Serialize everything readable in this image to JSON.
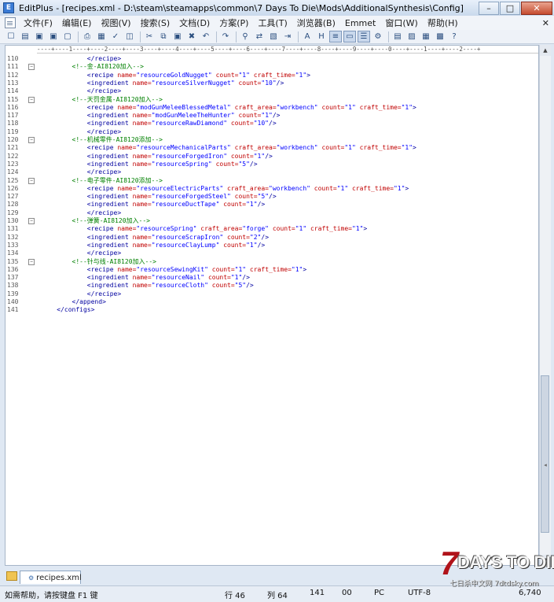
{
  "window": {
    "app_icon": "E",
    "title": "EditPlus - [recipes.xml - D:\\steam\\steamapps\\common\\7 Days To Die\\Mods\\AdditionalSynthesis\\Config]",
    "minimize": "–",
    "maximize": "□",
    "close": "✕"
  },
  "menubar": {
    "items": [
      "文件(F)",
      "编辑(E)",
      "视图(V)",
      "搜索(S)",
      "文档(D)",
      "方案(P)",
      "工具(T)",
      "浏览器(B)",
      "Emmet",
      "窗口(W)",
      "帮助(H)"
    ],
    "mdi_close": "✕"
  },
  "toolbar": {
    "icons": [
      "new-file-icon",
      "open-folder-icon",
      "save-icon",
      "save-all-icon",
      "close-file-icon",
      "print-icon",
      "print-preview-icon",
      "spell-check-icon",
      "browser-preview-icon",
      "cut-icon",
      "copy-icon",
      "paste-icon",
      "delete-icon",
      "undo-icon",
      "redo-icon",
      "find-icon",
      "replace-icon",
      "find-in-files-icon",
      "goto-line-icon",
      "font-icon",
      "heading-icon",
      "word-wrap-icon",
      "ruler-toggle-icon",
      "line-numbers-icon",
      "settings-icon",
      "window-tile-icon",
      "window-cascade-icon",
      "window-list-icon",
      "window-arrange-icon",
      "help-icon"
    ],
    "glyphs": [
      "☐",
      "▤",
      "▣",
      "▣",
      "▢",
      "⎙",
      "▦",
      "✓",
      "◫",
      "✂",
      "⧉",
      "▣",
      "✖",
      "↶",
      "↷",
      "⚲",
      "⇄",
      "▧",
      "⇥",
      "A",
      "H",
      "≡",
      "▭",
      "☰",
      "⚙",
      "▤",
      "▨",
      "▦",
      "▩",
      "?"
    ]
  },
  "editor": {
    "ruler": "----+----1----+----2----+----3----+----4----+----5----+----6----+----7----+----8----+----9----+----0----+----1----+----2----+",
    "lines": [
      {
        "n": "110",
        "fold": false,
        "segs": [
          [
            "txt",
            "            "
          ],
          [
            "tag",
            "</recipe>"
          ]
        ]
      },
      {
        "n": "111",
        "fold": true,
        "segs": [
          [
            "txt",
            "        "
          ],
          [
            "cmt",
            "<!--金-AI8120加入-->"
          ]
        ]
      },
      {
        "n": "112",
        "fold": false,
        "segs": [
          [
            "txt",
            "            "
          ],
          [
            "tag",
            "<recipe "
          ],
          [
            "attr",
            "name="
          ],
          [
            "val",
            "\"resourceGoldNugget\""
          ],
          [
            "attr",
            " count="
          ],
          [
            "val",
            "\"1\""
          ],
          [
            "attr",
            " craft_time="
          ],
          [
            "val",
            "\"1\""
          ],
          [
            "tag",
            ">"
          ]
        ]
      },
      {
        "n": "113",
        "fold": false,
        "segs": [
          [
            "txt",
            "            "
          ],
          [
            "tag",
            "<ingredient "
          ],
          [
            "attr",
            "name="
          ],
          [
            "val",
            "\"resourceSilverNugget\""
          ],
          [
            "attr",
            " count="
          ],
          [
            "val",
            "\"10\""
          ],
          [
            "tag",
            "/>"
          ]
        ]
      },
      {
        "n": "114",
        "fold": false,
        "segs": [
          [
            "txt",
            "            "
          ],
          [
            "tag",
            "</recipe>"
          ]
        ]
      },
      {
        "n": "115",
        "fold": true,
        "segs": [
          [
            "txt",
            "        "
          ],
          [
            "cmt",
            "<!--天罚金属-AI8120加入-->"
          ]
        ]
      },
      {
        "n": "116",
        "fold": false,
        "segs": [
          [
            "txt",
            "            "
          ],
          [
            "tag",
            "<recipe "
          ],
          [
            "attr",
            "name="
          ],
          [
            "val",
            "\"modGunMeleeBlessedMetal\""
          ],
          [
            "attr",
            " craft_area="
          ],
          [
            "val",
            "\"workbench\""
          ],
          [
            "attr",
            " count="
          ],
          [
            "val",
            "\"1\""
          ],
          [
            "attr",
            " craft_time="
          ],
          [
            "val",
            "\"1\""
          ],
          [
            "tag",
            ">"
          ]
        ]
      },
      {
        "n": "117",
        "fold": false,
        "segs": [
          [
            "txt",
            "            "
          ],
          [
            "tag",
            "<ingredient "
          ],
          [
            "attr",
            "name="
          ],
          [
            "val",
            "\"modGunMeleeTheHunter\""
          ],
          [
            "attr",
            " count="
          ],
          [
            "val",
            "\"1\""
          ],
          [
            "tag",
            "/>"
          ]
        ]
      },
      {
        "n": "118",
        "fold": false,
        "segs": [
          [
            "txt",
            "            "
          ],
          [
            "tag",
            "<ingredient "
          ],
          [
            "attr",
            "name="
          ],
          [
            "val",
            "\"resourceRawDiamond\""
          ],
          [
            "attr",
            " count="
          ],
          [
            "val",
            "\"10\""
          ],
          [
            "tag",
            "/>"
          ]
        ]
      },
      {
        "n": "119",
        "fold": false,
        "segs": [
          [
            "txt",
            "            "
          ],
          [
            "tag",
            "</recipe>"
          ]
        ]
      },
      {
        "n": "120",
        "fold": true,
        "segs": [
          [
            "txt",
            "        "
          ],
          [
            "cmt",
            "<!--机械零件-AI8120添加-->"
          ]
        ]
      },
      {
        "n": "121",
        "fold": false,
        "segs": [
          [
            "txt",
            "            "
          ],
          [
            "tag",
            "<recipe "
          ],
          [
            "attr",
            "name="
          ],
          [
            "val",
            "\"resourceMechanicalParts\""
          ],
          [
            "attr",
            " craft_area="
          ],
          [
            "val",
            "\"workbench\""
          ],
          [
            "attr",
            " count="
          ],
          [
            "val",
            "\"1\""
          ],
          [
            "attr",
            " craft_time="
          ],
          [
            "val",
            "\"1\""
          ],
          [
            "tag",
            ">"
          ]
        ]
      },
      {
        "n": "122",
        "fold": false,
        "segs": [
          [
            "txt",
            "            "
          ],
          [
            "tag",
            "<ingredient "
          ],
          [
            "attr",
            "name="
          ],
          [
            "val",
            "\"resourceForgedIron\""
          ],
          [
            "attr",
            " count="
          ],
          [
            "val",
            "\"1\""
          ],
          [
            "tag",
            "/>"
          ]
        ]
      },
      {
        "n": "123",
        "fold": false,
        "segs": [
          [
            "txt",
            "            "
          ],
          [
            "tag",
            "<ingredient "
          ],
          [
            "attr",
            "name="
          ],
          [
            "val",
            "\"resourceSpring\""
          ],
          [
            "attr",
            " count="
          ],
          [
            "val",
            "\"5\""
          ],
          [
            "tag",
            "/>"
          ]
        ]
      },
      {
        "n": "124",
        "fold": false,
        "segs": [
          [
            "txt",
            "            "
          ],
          [
            "tag",
            "</recipe>"
          ]
        ]
      },
      {
        "n": "125",
        "fold": true,
        "segs": [
          [
            "txt",
            "        "
          ],
          [
            "cmt",
            "<!--电子零件-AI8120添加-->"
          ]
        ]
      },
      {
        "n": "126",
        "fold": false,
        "segs": [
          [
            "txt",
            "            "
          ],
          [
            "tag",
            "<recipe "
          ],
          [
            "attr",
            "name="
          ],
          [
            "val",
            "\"resourceElectricParts\""
          ],
          [
            "attr",
            " craft_area="
          ],
          [
            "val",
            "\"workbench\""
          ],
          [
            "attr",
            " count="
          ],
          [
            "val",
            "\"1\""
          ],
          [
            "attr",
            " craft_time="
          ],
          [
            "val",
            "\"1\""
          ],
          [
            "tag",
            ">"
          ]
        ]
      },
      {
        "n": "127",
        "fold": false,
        "segs": [
          [
            "txt",
            "            "
          ],
          [
            "tag",
            "<ingredient "
          ],
          [
            "attr",
            "name="
          ],
          [
            "val",
            "\"resourceForgedSteel\""
          ],
          [
            "attr",
            " count="
          ],
          [
            "val",
            "\"5\""
          ],
          [
            "tag",
            "/>"
          ]
        ]
      },
      {
        "n": "128",
        "fold": false,
        "segs": [
          [
            "txt",
            "            "
          ],
          [
            "tag",
            "<ingredient "
          ],
          [
            "attr",
            "name="
          ],
          [
            "val",
            "\"resourceDuctTape\""
          ],
          [
            "attr",
            " count="
          ],
          [
            "val",
            "\"1\""
          ],
          [
            "tag",
            "/>"
          ]
        ]
      },
      {
        "n": "129",
        "fold": false,
        "segs": [
          [
            "txt",
            "            "
          ],
          [
            "tag",
            "</recipe>"
          ]
        ]
      },
      {
        "n": "130",
        "fold": true,
        "segs": [
          [
            "txt",
            "        "
          ],
          [
            "cmt",
            "<!--弹簧-AI8120加入-->"
          ]
        ]
      },
      {
        "n": "131",
        "fold": false,
        "segs": [
          [
            "txt",
            "            "
          ],
          [
            "tag",
            "<recipe "
          ],
          [
            "attr",
            "name="
          ],
          [
            "val",
            "\"resourceSpring\""
          ],
          [
            "attr",
            " craft_area="
          ],
          [
            "val",
            "\"forge\""
          ],
          [
            "attr",
            " count="
          ],
          [
            "val",
            "\"1\""
          ],
          [
            "attr",
            " craft_time="
          ],
          [
            "val",
            "\"1\""
          ],
          [
            "tag",
            ">"
          ]
        ]
      },
      {
        "n": "132",
        "fold": false,
        "segs": [
          [
            "txt",
            "            "
          ],
          [
            "tag",
            "<ingredient "
          ],
          [
            "attr",
            "name="
          ],
          [
            "val",
            "\"resourceScrapIron\""
          ],
          [
            "attr",
            " count="
          ],
          [
            "val",
            "\"2\""
          ],
          [
            "tag",
            "/>"
          ]
        ]
      },
      {
        "n": "133",
        "fold": false,
        "segs": [
          [
            "txt",
            "            "
          ],
          [
            "tag",
            "<ingredient "
          ],
          [
            "attr",
            "name="
          ],
          [
            "val",
            "\"resourceClayLump\""
          ],
          [
            "attr",
            " count="
          ],
          [
            "val",
            "\"1\""
          ],
          [
            "tag",
            "/>"
          ]
        ]
      },
      {
        "n": "134",
        "fold": false,
        "segs": [
          [
            "txt",
            "            "
          ],
          [
            "tag",
            "</recipe>"
          ]
        ]
      },
      {
        "n": "135",
        "fold": true,
        "segs": [
          [
            "txt",
            "        "
          ],
          [
            "cmt",
            "<!--针与线-AI8120加入-->"
          ]
        ]
      },
      {
        "n": "136",
        "fold": false,
        "segs": [
          [
            "txt",
            "            "
          ],
          [
            "tag",
            "<recipe "
          ],
          [
            "attr",
            "name="
          ],
          [
            "val",
            "\"resourceSewingKit\""
          ],
          [
            "attr",
            " count="
          ],
          [
            "val",
            "\"1\""
          ],
          [
            "attr",
            " craft_time="
          ],
          [
            "val",
            "\"1\""
          ],
          [
            "tag",
            ">"
          ]
        ]
      },
      {
        "n": "137",
        "fold": false,
        "segs": [
          [
            "txt",
            "            "
          ],
          [
            "tag",
            "<ingredient "
          ],
          [
            "attr",
            "name="
          ],
          [
            "val",
            "\"resourceNail\""
          ],
          [
            "attr",
            " count="
          ],
          [
            "val",
            "\"1\""
          ],
          [
            "tag",
            "/>"
          ]
        ]
      },
      {
        "n": "138",
        "fold": false,
        "segs": [
          [
            "txt",
            "            "
          ],
          [
            "tag",
            "<ingredient "
          ],
          [
            "attr",
            "name="
          ],
          [
            "val",
            "\"resourceCloth\""
          ],
          [
            "attr",
            " count="
          ],
          [
            "val",
            "\"5\""
          ],
          [
            "tag",
            "/>"
          ]
        ]
      },
      {
        "n": "139",
        "fold": false,
        "segs": [
          [
            "txt",
            "            "
          ],
          [
            "tag",
            "</recipe>"
          ]
        ]
      },
      {
        "n": "140",
        "fold": false,
        "segs": [
          [
            "txt",
            "        "
          ],
          [
            "tag",
            "</append>"
          ]
        ]
      },
      {
        "n": "141",
        "fold": false,
        "segs": [
          [
            "txt",
            "    "
          ],
          [
            "tag",
            "</configs>"
          ]
        ]
      }
    ]
  },
  "tabs": {
    "items": [
      "recipes.xml"
    ],
    "tab_icon": "⚙"
  },
  "statusbar": {
    "help": "如需帮助，请按键盘 F1 键",
    "line": "行 46",
    "col": "列 64",
    "num1": "141",
    "num2": "00",
    "mode": "PC",
    "encoding": "UTF-8",
    "size": "6,740"
  },
  "watermark": {
    "seven": "7",
    "title": "DAYS TO DIE",
    "subtitle": "七日杀中文网 7dtdsky.com"
  },
  "colors": {
    "tag": "#0000a0",
    "attr": "#c00000",
    "value": "#0000ff",
    "comment": "#008000"
  }
}
